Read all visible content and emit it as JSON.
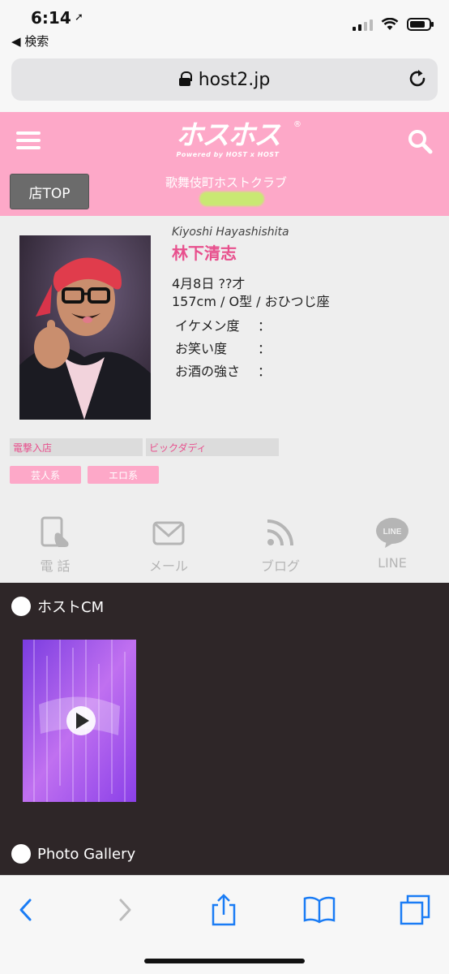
{
  "status_bar": {
    "time": "6:14",
    "back_app": "◀ 検索"
  },
  "browser": {
    "url": "host2.jp"
  },
  "header": {
    "logo_main": "ホスホス",
    "logo_sub": "Powered by HOST x HOST",
    "logo_reg": "®",
    "shop_top_label": "店TOP",
    "club_type": "歌舞伎町ホストクラブ"
  },
  "profile": {
    "romaji": "Kiyoshi Hayashishita",
    "name": "林下清志",
    "birth": "4月8日 ??才",
    "stats": "157cm / O型 / おひつじ座",
    "ratings": [
      {
        "label": "イケメン度",
        "sep": "："
      },
      {
        "label": "お笑い度",
        "sep": "："
      },
      {
        "label": "お酒の強さ",
        "sep": "："
      }
    ],
    "tags_wide": [
      "電撃入店",
      "ビックダディ"
    ],
    "tags_pink": [
      "芸人系",
      "エロ系"
    ]
  },
  "contacts": [
    {
      "label": "電 話",
      "icon": "phone-icon"
    },
    {
      "label": "メール",
      "icon": "mail-icon"
    },
    {
      "label": "ブログ",
      "icon": "rss-icon"
    },
    {
      "label": "LINE",
      "icon": "line-icon"
    }
  ],
  "line_icon_text": "LINE",
  "sections": {
    "cm_title": "ホストCM",
    "gallery_title": "Photo Gallery"
  },
  "colors": {
    "brand_pink": "#fda8c8",
    "name_pink": "#e8508d",
    "dark_bg": "#2e2628",
    "ios_blue": "#1a7cf5"
  }
}
